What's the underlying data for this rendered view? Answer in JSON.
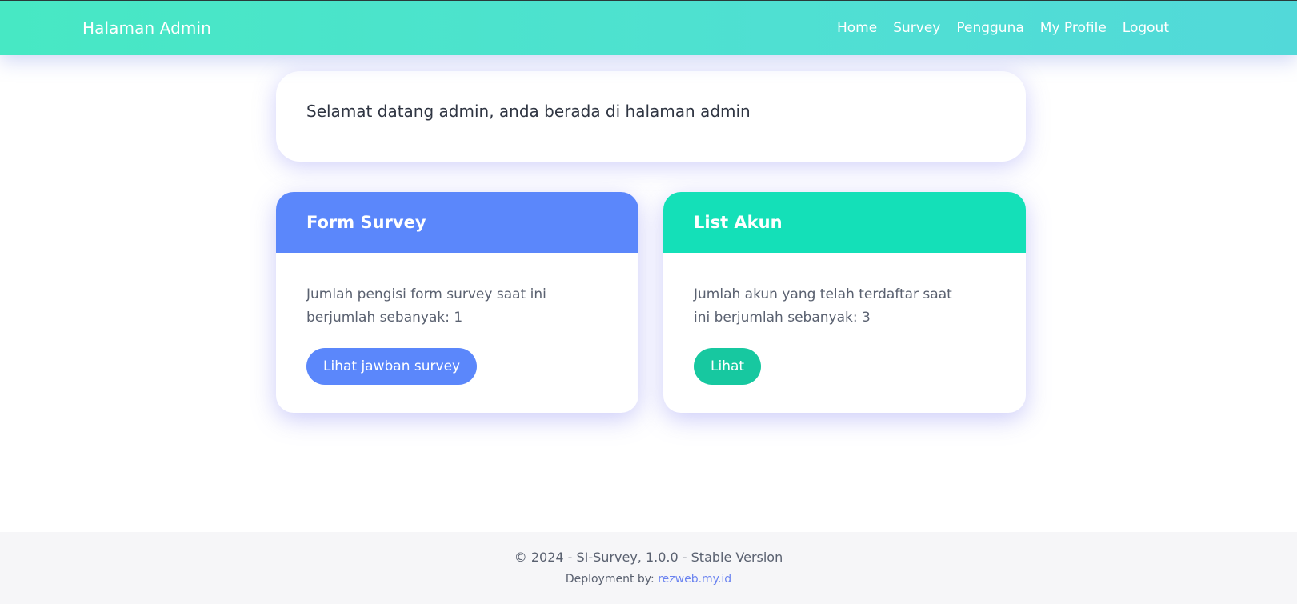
{
  "navbar": {
    "brand": "Halaman Admin",
    "links": [
      "Home",
      "Survey",
      "Pengguna",
      "My Profile",
      "Logout"
    ]
  },
  "welcome": {
    "text": "Selamat datang admin, anda berada di halaman admin"
  },
  "cards": {
    "survey": {
      "title": "Form Survey",
      "text": "Jumlah pengisi form survey saat ini berjumlah sebanyak: 1",
      "button": "Lihat jawban survey"
    },
    "accounts": {
      "title": "List Akun",
      "text": "Jumlah akun yang telah terdaftar saat ini berjumlah sebanyak: 3",
      "button": "Lihat"
    }
  },
  "footer": {
    "main": "© 2024 - SI-Survey, 1.0.0 - Stable Version",
    "deploy_label": "Deployment by:",
    "deploy_link": "rezweb.my.id"
  },
  "colors": {
    "navbar_gradient_start": "#47e8c4",
    "navbar_gradient_end": "#52d9d9",
    "survey_accent": "#5b87fb",
    "accounts_header": "#14e0b8",
    "accounts_button": "#17c8a0",
    "footer_link": "#6c84f0"
  }
}
